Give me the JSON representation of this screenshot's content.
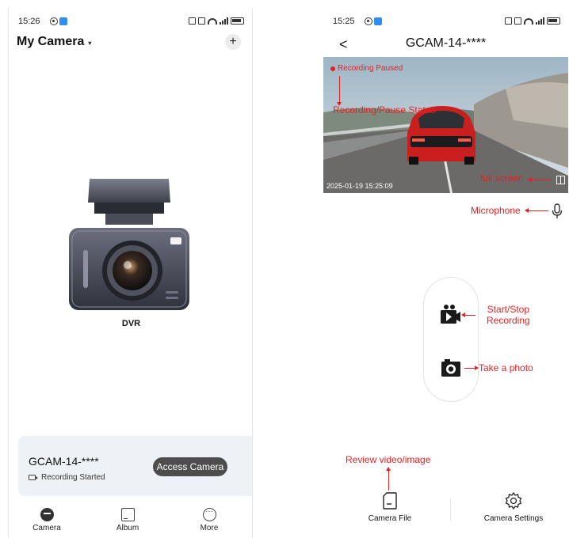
{
  "left_screen": {
    "status_time": "15:26",
    "title": "My Camera",
    "title_caret": "▾",
    "add_symbol": "+",
    "device_label": "DVR",
    "card": {
      "device_name": "GCAM-14-****",
      "status": "Recording Started",
      "access_button": "Access Camera"
    },
    "nav": [
      {
        "label": "Camera",
        "icon": "camera-tab-icon"
      },
      {
        "label": "Album",
        "icon": "album-icon"
      },
      {
        "label": "More",
        "icon": "more-icon"
      }
    ]
  },
  "right_screen": {
    "status_time": "15:25",
    "back_symbol": "<",
    "device_name": "GCAM-14-****",
    "live_view": {
      "status_text": "Recording Paused",
      "timestamp": "2025-01-19 15:25:09"
    },
    "annotations": {
      "record_status": "Recording/Pause Status",
      "full_screen": "full screen",
      "microphone": "Microphone",
      "start_stop_line1": "Start/Stop",
      "start_stop_line2": "Recording",
      "take_photo": "Take a photo",
      "review": "Review video/image"
    },
    "tools": [
      {
        "label": "Camera File",
        "icon": "sd-card-icon"
      },
      {
        "label": "Camera Settings",
        "icon": "gear-icon"
      }
    ]
  },
  "colors": {
    "annotation_red": "#e52222",
    "card_background": "#eef2f7",
    "access_button": "#4d4d4d"
  }
}
